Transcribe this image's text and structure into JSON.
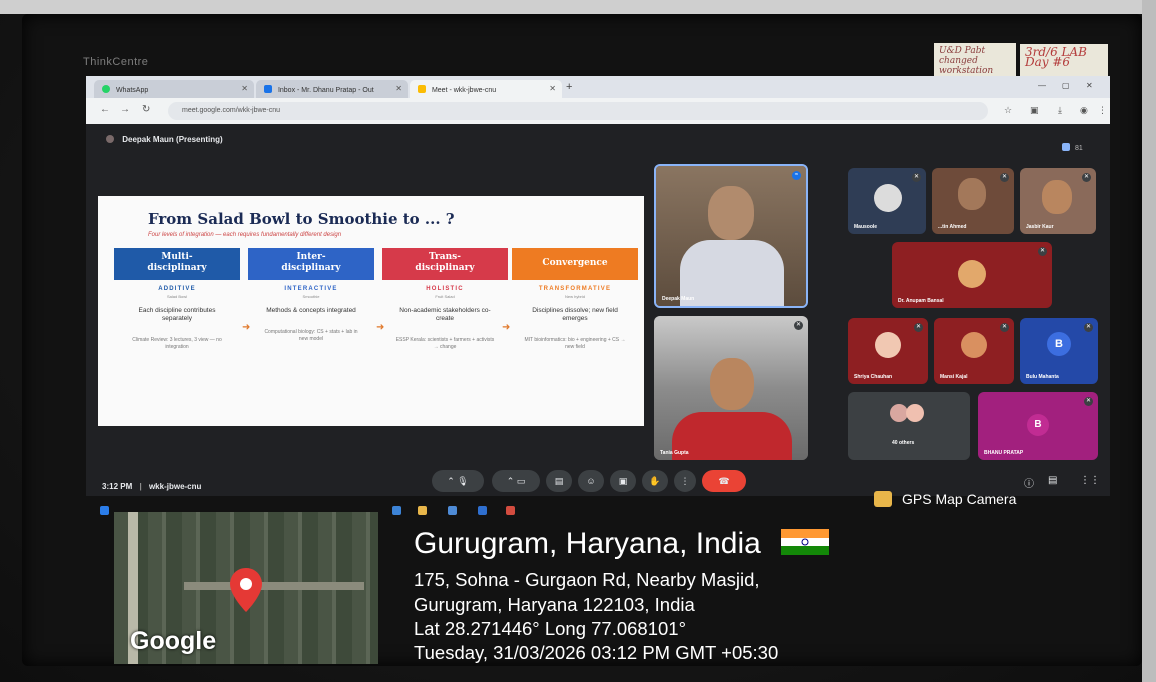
{
  "monitor": {
    "brand": "ThinkCentre"
  },
  "sticky_notes": {
    "left": "U&D Pabt changed workstation",
    "right": "3rd/6 LAB Day #6"
  },
  "browser": {
    "tabs": [
      {
        "label": "WhatsApp",
        "icon": "whatsapp-icon"
      },
      {
        "label": "Inbox - Mr. Dhanu Pratap - Out",
        "icon": "outlook-icon"
      },
      {
        "label": "Meet - wkk-jbwe-cnu",
        "icon": "meet-icon"
      }
    ],
    "url": "meet.google.com/wkk-jbwe-cnu"
  },
  "meet": {
    "presenter_label": "Deepak Maun (Presenting)",
    "participant_count": "81",
    "clock": "3:12 PM",
    "meeting_code": "wkk-jbwe-cnu",
    "participants": [
      {
        "name": "Deepak Maun"
      },
      {
        "name": "Tania Gupta"
      },
      {
        "name": "Mausoole"
      },
      {
        "name": "...tin Ahmed"
      },
      {
        "name": "Jasbir Kaur"
      },
      {
        "name": "Dr. Anupam Bansal"
      },
      {
        "name": "Shriya Chauhan"
      },
      {
        "name": "Mansi Kajal"
      },
      {
        "name": "Bulu Mahanta",
        "initial": "B"
      },
      {
        "name": "40 others"
      },
      {
        "name": "BHANU PRATAP",
        "initial": "B"
      }
    ]
  },
  "slide": {
    "title": "From Salad Bowl to Smoothie to ... ?",
    "subtitle": "Four levels of integration — each requires fundamentally different design",
    "columns": [
      {
        "heading": "Multi-\ndisciplinary",
        "tag": "ADDITIVE",
        "small": "Salad Bowl",
        "body": "Each discipline contributes separately",
        "example": "Climate Review: 3 lectures, 3 view — no integration",
        "color": "#1f5aa8"
      },
      {
        "heading": "Inter-\ndisciplinary",
        "tag": "INTERACTIVE",
        "small": "Smoothie",
        "body": "Methods & concepts integrated",
        "example": "Computational biology: CS + stats + lab in new model",
        "color": "#2e64c6"
      },
      {
        "heading": "Trans-\ndisciplinary",
        "tag": "HOLISTIC",
        "small": "Fruit Salad",
        "body": "Non-academic stakeholders co-create",
        "example": "ESSP Kerala: scientists + farmers + activists → change",
        "color": "#d63a4a"
      },
      {
        "heading": "Convergence",
        "tag": "TRANSFORMATIVE",
        "small": "New hybrid",
        "body": "Disciplines dissolve; new field emerges",
        "example": "MIT bioinformatics: bio + engineering + CS → new field",
        "color": "#ee7b22"
      }
    ]
  },
  "gps": {
    "app": "GPS Map Camera",
    "city": "Gurugram, Haryana, India",
    "address1": "175, Sohna - Gurgaon Rd, Nearby Masjid,",
    "address2": "Gurugram, Haryana 122103, India",
    "coords": "Lat 28.271446° Long 77.068101°",
    "datetime": "Tuesday, 31/03/2026 03:12 PM GMT +05:30",
    "map_logo": "Google"
  },
  "colors": {
    "accent_end_call": "#ea4335",
    "meet_bg": "#202124"
  }
}
